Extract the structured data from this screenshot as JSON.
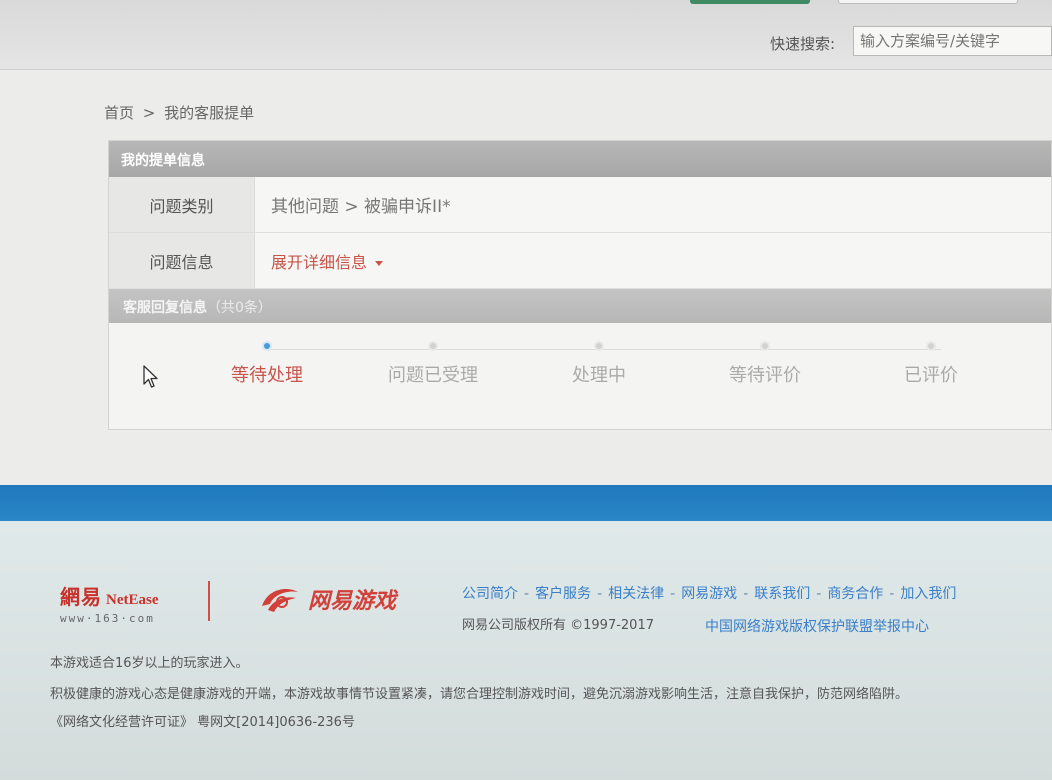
{
  "header": {
    "quick_search_label": "快速搜索:",
    "search_placeholder": "输入方案编号/关键字"
  },
  "breadcrumb": {
    "home": "首页",
    "separator": ">",
    "current": "我的客服提单"
  },
  "ticket": {
    "section_title": "我的提单信息",
    "rows": [
      {
        "label": "问题类别",
        "value": "其他问题 > 被骗申诉II*"
      },
      {
        "label": "问题信息",
        "value": "展开详细信息"
      }
    ]
  },
  "reply": {
    "section_title": "客服回复信息",
    "count_text": "（共0条）"
  },
  "progress": {
    "steps": [
      {
        "label": "等待处理",
        "active": true
      },
      {
        "label": "问题已受理",
        "active": false
      },
      {
        "label": "处理中",
        "active": false
      },
      {
        "label": "等待评价",
        "active": false
      },
      {
        "label": "已评价",
        "active": false
      }
    ]
  },
  "footer": {
    "logo_cn": "網易",
    "logo_en": "NetEase",
    "logo_url": "www·163·com",
    "games_logo": "网易游戏",
    "links": [
      "公司简介",
      "客户服务",
      "相关法律",
      "网易游戏",
      "联系我们",
      "商务合作",
      "加入我们"
    ],
    "link_separator": "-",
    "copyright": "网易公司版权所有 ©1997-2017",
    "report_link": "中国网络游戏版权保护联盟举报中心",
    "age_notice": "本游戏适合16岁以上的玩家进入。",
    "health_notice": "积极健康的游戏心态是健康游戏的开端，本游戏故事情节设置紧凑，请您合理控制游戏时间，避免沉溺游戏影响生活，注意自我保护，防范网络陷阱。",
    "license": "《网络文化经营许可证》 粤网文[2014]0636-236号"
  },
  "colors": {
    "accent_red": "#c8544a",
    "link_blue": "#3a7fc8",
    "band_blue": "#1f78bd",
    "active_dot": "#4a9ad6"
  }
}
